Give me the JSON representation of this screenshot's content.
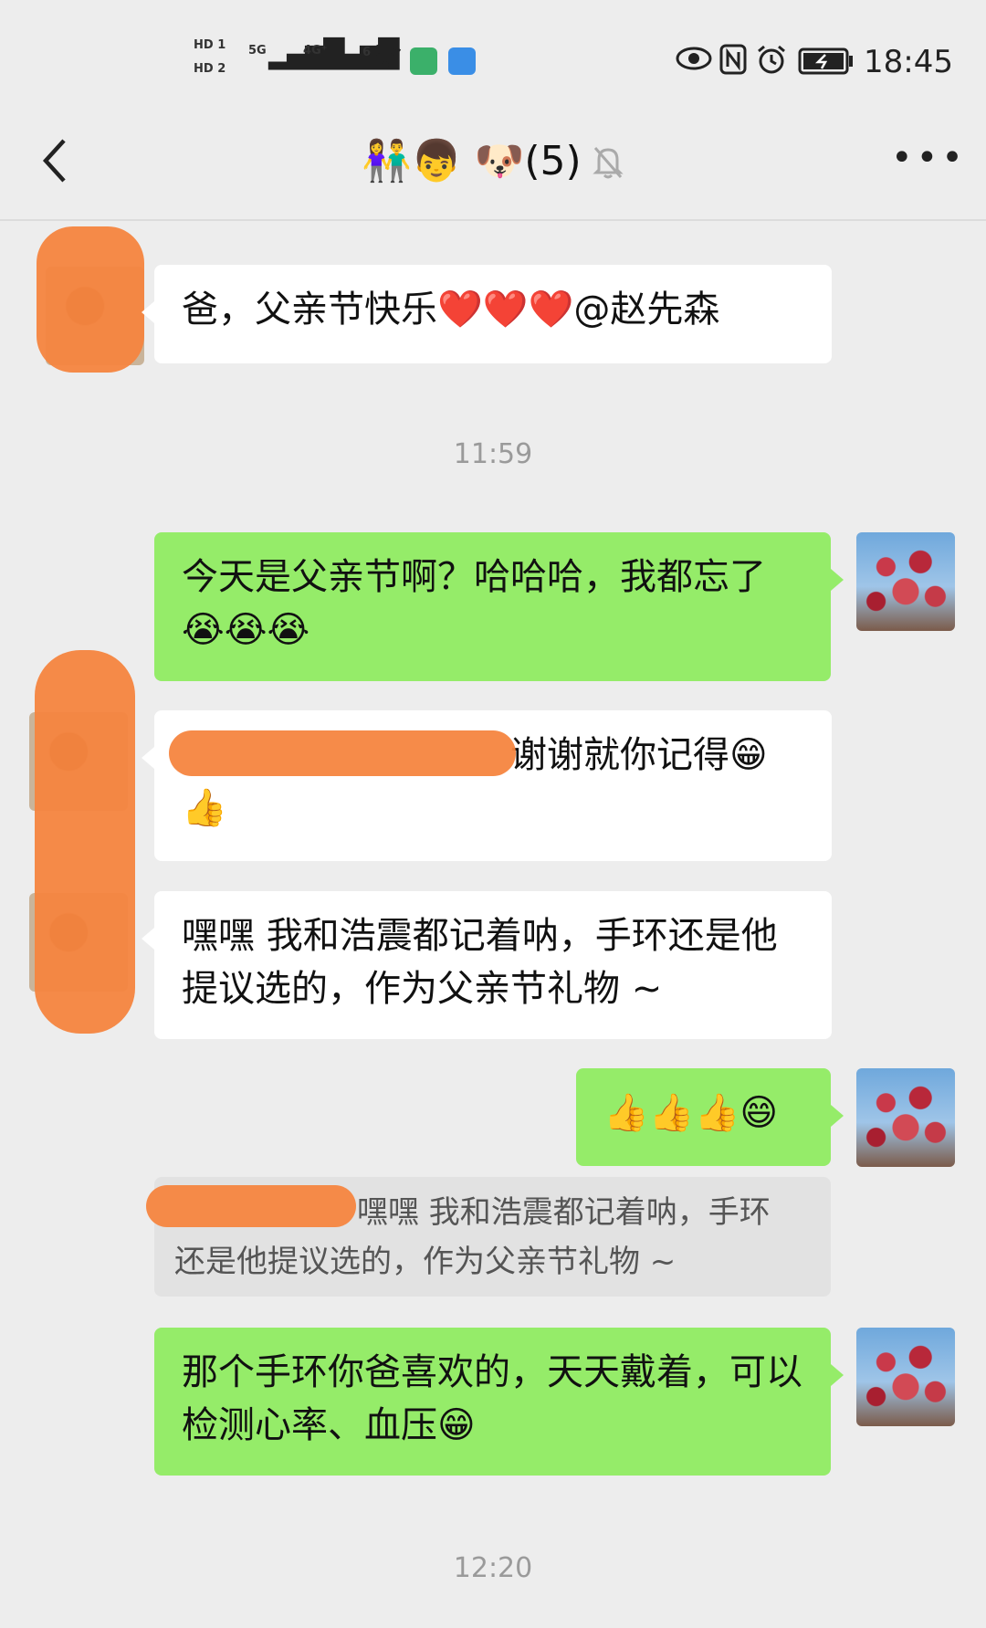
{
  "status_bar": {
    "hd1": "HD 1",
    "hd2": "HD 2",
    "net1": "5G",
    "net2": "4G⁺",
    "net_sub": "6",
    "time": "18:45"
  },
  "header": {
    "back_icon": "chevron-left-icon",
    "title_emojis": "👫👦 🐶",
    "member_count": "(5)",
    "mute_icon": "bell-muted-icon",
    "more_label": "•••"
  },
  "messages": [
    {
      "side": "left",
      "text": "爸，父亲节快乐❤️❤️❤️@赵先森"
    },
    {
      "side": "timestamp",
      "text": "11:59"
    },
    {
      "side": "right",
      "text": "今天是父亲节啊？哈哈哈，我都忘了😭😭😭"
    },
    {
      "side": "left",
      "text_line1": "谢谢就你记得😁",
      "text_line2": "👍"
    },
    {
      "side": "left",
      "text": "嘿嘿 我和浩震都记着呐，手环还是他提议选的，作为父亲节礼物 ~"
    },
    {
      "side": "right",
      "text": "👍👍👍😄"
    },
    {
      "side": "quote",
      "text_line1": "嘿嘿 我和浩震都记着呐，手环",
      "text_line2": "还是他提议选的，作为父亲节礼物 ~"
    },
    {
      "side": "right",
      "text": "那个手环你爸喜欢的，天天戴着，可以检测心率、血压😁"
    },
    {
      "side": "timestamp",
      "text": "12:20"
    }
  ],
  "colors": {
    "background": "#ededed",
    "bubble_self": "#95ec69",
    "bubble_other": "#ffffff",
    "redaction": "#f6853f"
  }
}
